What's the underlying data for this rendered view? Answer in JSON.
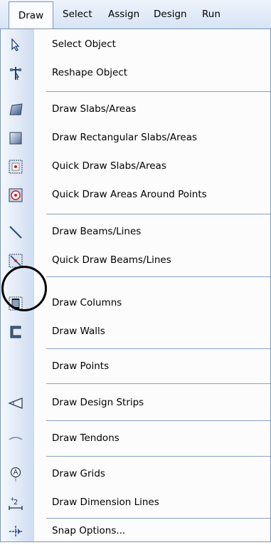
{
  "menubar": {
    "items": [
      "Draw",
      "Select",
      "Assign",
      "Design",
      "Run"
    ]
  },
  "menu": {
    "items": [
      {
        "label": "Select Object",
        "icon": "pointer-icon"
      },
      {
        "label": "Reshape Object",
        "icon": "reshape-icon"
      },
      {
        "label": "Draw Slabs/Areas",
        "icon": "slab-icon"
      },
      {
        "label": "Draw Rectangular Slabs/Areas",
        "icon": "rect-slab-icon"
      },
      {
        "label": "Quick Draw Slabs/Areas",
        "icon": "quick-slab-icon"
      },
      {
        "label": "Quick Draw Areas Around Points",
        "icon": "area-points-icon"
      },
      {
        "label": "Draw Beams/Lines",
        "icon": "beam-line-icon"
      },
      {
        "label": "Quick Draw Beams/Lines",
        "icon": "quick-beam-icon"
      },
      {
        "label": "Draw Columns",
        "icon": "column-icon"
      },
      {
        "label": "Draw Walls",
        "icon": "wall-icon"
      },
      {
        "label": "Draw Points",
        "icon": ""
      },
      {
        "label": "Draw Design Strips",
        "icon": "design-strip-icon"
      },
      {
        "label": "Draw Tendons",
        "icon": "tendon-icon"
      },
      {
        "label": "Draw Grids",
        "icon": "grid-bubble-icon"
      },
      {
        "label": "Draw Dimension Lines",
        "icon": "dimension-icon"
      },
      {
        "label": "Snap Options...",
        "icon": "snap-icon"
      }
    ]
  }
}
